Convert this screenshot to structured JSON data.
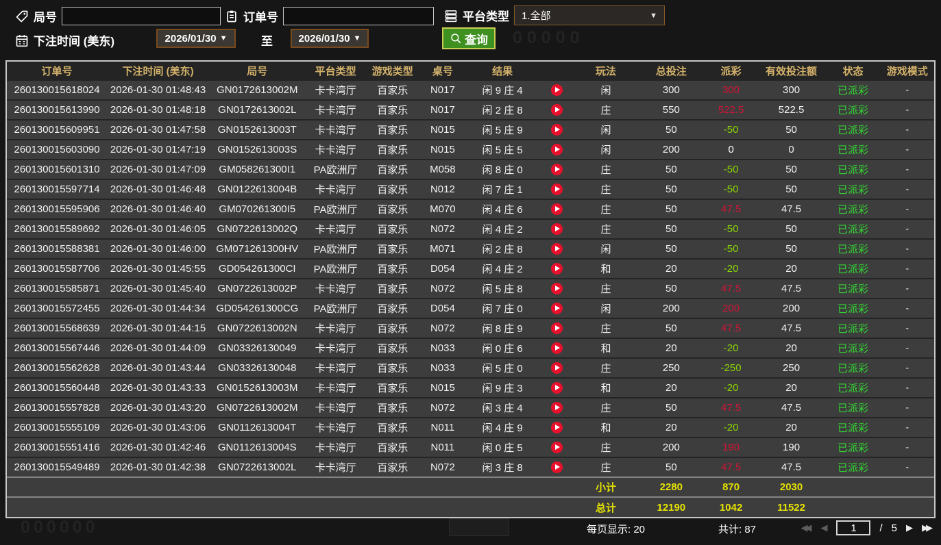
{
  "filters": {
    "round": {
      "label": "局号",
      "value": ""
    },
    "order": {
      "label": "订单号",
      "value": ""
    },
    "platform": {
      "label": "平台类型",
      "value": "1.全部"
    },
    "bet_time": {
      "label": "下注时间 (美东)",
      "from": "2026/01/30",
      "to_label": "至",
      "to": "2026/01/30"
    },
    "search_label": "查询"
  },
  "icons": {
    "arrow_down": "▼",
    "prev_page": "◀",
    "first_page": "◀◀",
    "next_page": "▶",
    "last_page": "▶▶"
  },
  "table": {
    "columns": [
      "订单号",
      "下注时间 (美东)",
      "局号",
      "平台类型",
      "游戏类型",
      "桌号",
      "结果",
      "",
      "玩法",
      "总投注",
      "派彩",
      "有效投注额",
      "状态",
      "游戏模式"
    ],
    "rows": [
      {
        "order_id": "260130015618024",
        "bet_time": "2026-01-30 01:48:43",
        "round_id": "GN0172613002M",
        "platform": "卡卡湾厅",
        "game_type": "百家乐",
        "table_no": "N017",
        "result": "闲 9 庄 4",
        "bet_on": "闲",
        "total_bet": "300",
        "payout": "300",
        "payout_type": "win",
        "valid_bet": "300",
        "status": "已派彩",
        "mode": "-"
      },
      {
        "order_id": "260130015613990",
        "bet_time": "2026-01-30 01:48:18",
        "round_id": "GN0172613002L",
        "platform": "卡卡湾厅",
        "game_type": "百家乐",
        "table_no": "N017",
        "result": "闲 2 庄 8",
        "bet_on": "庄",
        "total_bet": "550",
        "payout": "522.5",
        "payout_type": "win",
        "valid_bet": "522.5",
        "status": "已派彩",
        "mode": "-"
      },
      {
        "order_id": "260130015609951",
        "bet_time": "2026-01-30 01:47:58",
        "round_id": "GN0152613003T",
        "platform": "卡卡湾厅",
        "game_type": "百家乐",
        "table_no": "N015",
        "result": "闲 5 庄 9",
        "bet_on": "闲",
        "total_bet": "50",
        "payout": "-50",
        "payout_type": "loss",
        "valid_bet": "50",
        "status": "已派彩",
        "mode": "-"
      },
      {
        "order_id": "260130015603090",
        "bet_time": "2026-01-30 01:47:19",
        "round_id": "GN0152613003S",
        "platform": "卡卡湾厅",
        "game_type": "百家乐",
        "table_no": "N015",
        "result": "闲 5 庄 5",
        "bet_on": "闲",
        "total_bet": "200",
        "payout": "0",
        "payout_type": "zero",
        "valid_bet": "0",
        "status": "已派彩",
        "mode": "-"
      },
      {
        "order_id": "260130015601310",
        "bet_time": "2026-01-30 01:47:09",
        "round_id": "GM058261300I1",
        "platform": "PA欧洲厅",
        "game_type": "百家乐",
        "table_no": "M058",
        "result": "闲 8 庄 0",
        "bet_on": "庄",
        "total_bet": "50",
        "payout": "-50",
        "payout_type": "loss",
        "valid_bet": "50",
        "status": "已派彩",
        "mode": "-"
      },
      {
        "order_id": "260130015597714",
        "bet_time": "2026-01-30 01:46:48",
        "round_id": "GN0122613004B",
        "platform": "卡卡湾厅",
        "game_type": "百家乐",
        "table_no": "N012",
        "result": "闲 7 庄 1",
        "bet_on": "庄",
        "total_bet": "50",
        "payout": "-50",
        "payout_type": "loss",
        "valid_bet": "50",
        "status": "已派彩",
        "mode": "-"
      },
      {
        "order_id": "260130015595906",
        "bet_time": "2026-01-30 01:46:40",
        "round_id": "GM070261300I5",
        "platform": "PA欧洲厅",
        "game_type": "百家乐",
        "table_no": "M070",
        "result": "闲 4 庄 6",
        "bet_on": "庄",
        "total_bet": "50",
        "payout": "47.5",
        "payout_type": "win",
        "valid_bet": "47.5",
        "status": "已派彩",
        "mode": "-"
      },
      {
        "order_id": "260130015589692",
        "bet_time": "2026-01-30 01:46:05",
        "round_id": "GN0722613002Q",
        "platform": "卡卡湾厅",
        "game_type": "百家乐",
        "table_no": "N072",
        "result": "闲 4 庄 2",
        "bet_on": "庄",
        "total_bet": "50",
        "payout": "-50",
        "payout_type": "loss",
        "valid_bet": "50",
        "status": "已派彩",
        "mode": "-"
      },
      {
        "order_id": "260130015588381",
        "bet_time": "2026-01-30 01:46:00",
        "round_id": "GM071261300HV",
        "platform": "PA欧洲厅",
        "game_type": "百家乐",
        "table_no": "M071",
        "result": "闲 2 庄 8",
        "bet_on": "闲",
        "total_bet": "50",
        "payout": "-50",
        "payout_type": "loss",
        "valid_bet": "50",
        "status": "已派彩",
        "mode": "-"
      },
      {
        "order_id": "260130015587706",
        "bet_time": "2026-01-30 01:45:55",
        "round_id": "GD054261300CI",
        "platform": "PA欧洲厅",
        "game_type": "百家乐",
        "table_no": "D054",
        "result": "闲 4 庄 2",
        "bet_on": "和",
        "total_bet": "20",
        "payout": "-20",
        "payout_type": "loss",
        "valid_bet": "20",
        "status": "已派彩",
        "mode": "-"
      },
      {
        "order_id": "260130015585871",
        "bet_time": "2026-01-30 01:45:40",
        "round_id": "GN0722613002P",
        "platform": "卡卡湾厅",
        "game_type": "百家乐",
        "table_no": "N072",
        "result": "闲 5 庄 8",
        "bet_on": "庄",
        "total_bet": "50",
        "payout": "47.5",
        "payout_type": "win",
        "valid_bet": "47.5",
        "status": "已派彩",
        "mode": "-"
      },
      {
        "order_id": "260130015572455",
        "bet_time": "2026-01-30 01:44:34",
        "round_id": "GD054261300CG",
        "platform": "PA欧洲厅",
        "game_type": "百家乐",
        "table_no": "D054",
        "result": "闲 7 庄 0",
        "bet_on": "闲",
        "total_bet": "200",
        "payout": "200",
        "payout_type": "win",
        "valid_bet": "200",
        "status": "已派彩",
        "mode": "-"
      },
      {
        "order_id": "260130015568639",
        "bet_time": "2026-01-30 01:44:15",
        "round_id": "GN0722613002N",
        "platform": "卡卡湾厅",
        "game_type": "百家乐",
        "table_no": "N072",
        "result": "闲 8 庄 9",
        "bet_on": "庄",
        "total_bet": "50",
        "payout": "47.5",
        "payout_type": "win",
        "valid_bet": "47.5",
        "status": "已派彩",
        "mode": "-"
      },
      {
        "order_id": "260130015567446",
        "bet_time": "2026-01-30 01:44:09",
        "round_id": "GN03326130049",
        "platform": "卡卡湾厅",
        "game_type": "百家乐",
        "table_no": "N033",
        "result": "闲 0 庄 6",
        "bet_on": "和",
        "total_bet": "20",
        "payout": "-20",
        "payout_type": "loss",
        "valid_bet": "20",
        "status": "已派彩",
        "mode": "-"
      },
      {
        "order_id": "260130015562628",
        "bet_time": "2026-01-30 01:43:44",
        "round_id": "GN03326130048",
        "platform": "卡卡湾厅",
        "game_type": "百家乐",
        "table_no": "N033",
        "result": "闲 5 庄 0",
        "bet_on": "庄",
        "total_bet": "250",
        "payout": "-250",
        "payout_type": "loss",
        "valid_bet": "250",
        "status": "已派彩",
        "mode": "-"
      },
      {
        "order_id": "260130015560448",
        "bet_time": "2026-01-30 01:43:33",
        "round_id": "GN0152613003M",
        "platform": "卡卡湾厅",
        "game_type": "百家乐",
        "table_no": "N015",
        "result": "闲 9 庄 3",
        "bet_on": "和",
        "total_bet": "20",
        "payout": "-20",
        "payout_type": "loss",
        "valid_bet": "20",
        "status": "已派彩",
        "mode": "-"
      },
      {
        "order_id": "260130015557828",
        "bet_time": "2026-01-30 01:43:20",
        "round_id": "GN0722613002M",
        "platform": "卡卡湾厅",
        "game_type": "百家乐",
        "table_no": "N072",
        "result": "闲 3 庄 4",
        "bet_on": "庄",
        "total_bet": "50",
        "payout": "47.5",
        "payout_type": "win",
        "valid_bet": "47.5",
        "status": "已派彩",
        "mode": "-"
      },
      {
        "order_id": "260130015555109",
        "bet_time": "2026-01-30 01:43:06",
        "round_id": "GN0112613004T",
        "platform": "卡卡湾厅",
        "game_type": "百家乐",
        "table_no": "N011",
        "result": "闲 4 庄 9",
        "bet_on": "和",
        "total_bet": "20",
        "payout": "-20",
        "payout_type": "loss",
        "valid_bet": "20",
        "status": "已派彩",
        "mode": "-"
      },
      {
        "order_id": "260130015551416",
        "bet_time": "2026-01-30 01:42:46",
        "round_id": "GN0112613004S",
        "platform": "卡卡湾厅",
        "game_type": "百家乐",
        "table_no": "N011",
        "result": "闲 0 庄 5",
        "bet_on": "庄",
        "total_bet": "200",
        "payout": "190",
        "payout_type": "win",
        "valid_bet": "190",
        "status": "已派彩",
        "mode": "-"
      },
      {
        "order_id": "260130015549489",
        "bet_time": "2026-01-30 01:42:38",
        "round_id": "GN0722613002L",
        "platform": "卡卡湾厅",
        "game_type": "百家乐",
        "table_no": "N072",
        "result": "闲 3 庄 8",
        "bet_on": "庄",
        "total_bet": "50",
        "payout": "47.5",
        "payout_type": "win",
        "valid_bet": "47.5",
        "status": "已派彩",
        "mode": "-"
      }
    ],
    "subtotal": {
      "label": "小计",
      "total_bet": "2280",
      "payout": "870",
      "valid_bet": "2030"
    },
    "grand_total": {
      "label": "总计",
      "total_bet": "12190",
      "payout": "1042",
      "valid_bet": "11522"
    }
  },
  "footer": {
    "page_size": "每页显示: 20",
    "total_count": "共计: 87",
    "current_page": "1",
    "separator": "/",
    "total_pages": "5"
  },
  "watermarks": {
    "top_line1": "00000",
    "top_line2": "00000",
    "bottom": "000000"
  },
  "colors": {
    "page_bg": "#161616",
    "row_bg": "#3d3d3d",
    "header_bg": "#242424",
    "header_text": "#d4b26b",
    "win_red": "#d11437",
    "loss_green": "#8cd600",
    "status_green": "#33d433",
    "totals_yellow": "#e6e300",
    "date_border": "#7a4a1f",
    "search_green": "#3e9020",
    "play_red": "#e8112d"
  }
}
